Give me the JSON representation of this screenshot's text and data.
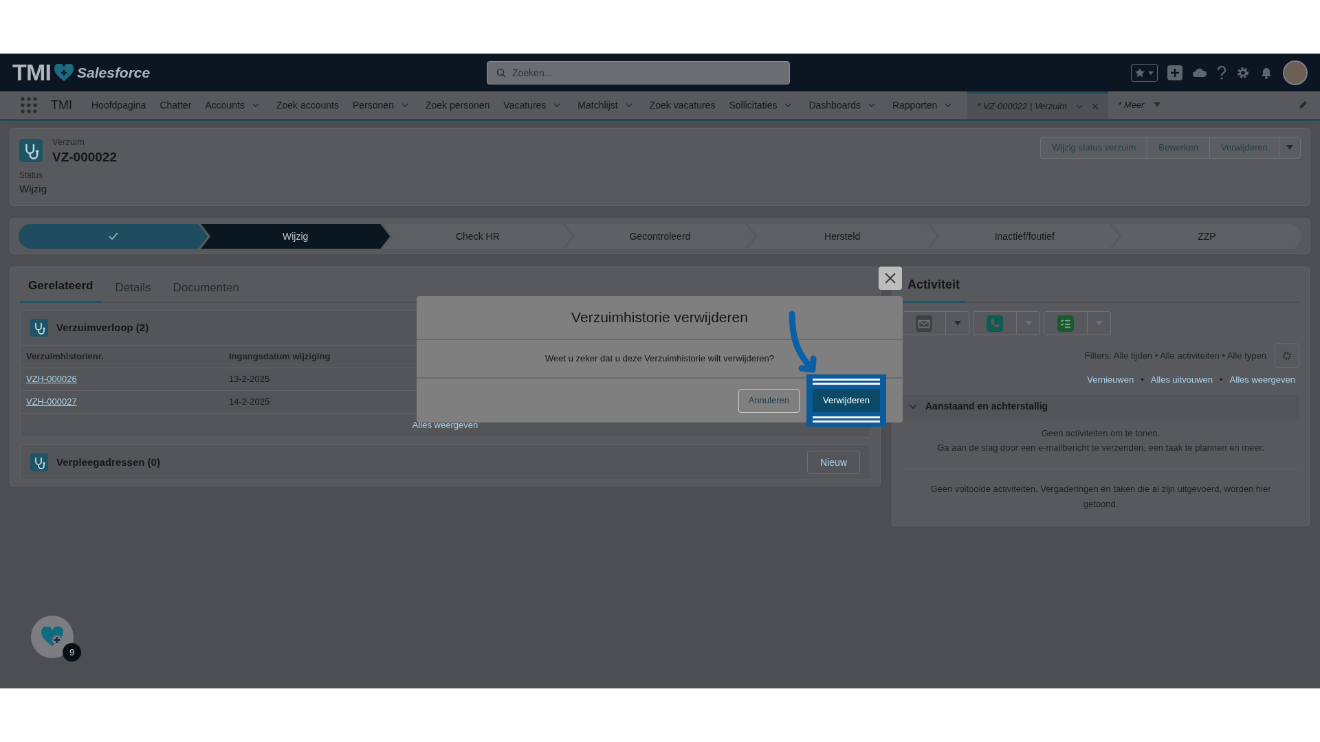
{
  "header": {
    "brand": "TMI",
    "brand_sub": "Salesforce",
    "search": {
      "placeholder": "Zoeken..."
    }
  },
  "app_name": "TMI",
  "nav": [
    {
      "label": "Hoofdpagina",
      "dropdown": false
    },
    {
      "label": "Chatter",
      "dropdown": false
    },
    {
      "label": "Accounts",
      "dropdown": true
    },
    {
      "label": "Zoek accounts",
      "dropdown": false
    },
    {
      "label": "Personen",
      "dropdown": true
    },
    {
      "label": "Zoek personen",
      "dropdown": false
    },
    {
      "label": "Vacatures",
      "dropdown": true
    },
    {
      "label": "Matchlijst",
      "dropdown": true
    },
    {
      "label": "Zoek vacatures",
      "dropdown": false
    },
    {
      "label": "Sollicitaties",
      "dropdown": true
    },
    {
      "label": "Dashboards",
      "dropdown": true
    },
    {
      "label": "Rapporten",
      "dropdown": true
    }
  ],
  "workspace_tab": {
    "label": "* VZ-000022 | Verzuim",
    "selected": true
  },
  "more_menu": {
    "label": "* Meer"
  },
  "record": {
    "object": "Verzuim",
    "name": "VZ-000022",
    "actions": [
      "Wijzig status verzuim",
      "Bewerken",
      "Verwijderen"
    ],
    "fields": [
      {
        "label": "Status",
        "value": "Wijzig"
      }
    ]
  },
  "path": [
    {
      "complete": true,
      "selected": false
    },
    {
      "label": "Wijzig",
      "complete": false,
      "selected": true
    },
    {
      "label": "Check HR",
      "complete": false,
      "selected": false
    },
    {
      "label": "Gecontroleerd",
      "complete": false,
      "selected": false
    },
    {
      "label": "Hersteld",
      "complete": false,
      "selected": false
    },
    {
      "label": "Inactief/foutief",
      "complete": false,
      "selected": false
    },
    {
      "label": "ZZP",
      "complete": false,
      "selected": false
    }
  ],
  "related_tabs": [
    {
      "label": "Gerelateerd",
      "selected": true
    },
    {
      "label": "Details",
      "selected": false
    },
    {
      "label": "Documenten",
      "selected": false
    }
  ],
  "related_lists": [
    {
      "kind": "table",
      "title": "Verzuimverloop (2)",
      "columns": [
        "Verzuimhistorienr.",
        "Ingangsdatum wijziging"
      ],
      "rows": [
        [
          "VZH-000026",
          "13-2-2025"
        ],
        [
          "VZH-000027",
          "14-2-2025"
        ]
      ],
      "footer_link": "Alles weergeven"
    },
    {
      "kind": "empty",
      "title": "Verpleegadressen (0)",
      "button": "Nieuw"
    }
  ],
  "modal": {
    "title": "Verzuimhistorie verwijderen",
    "message": "Weet u zeker dat u deze Verzuimhistorie wilt verwijderen?",
    "buttons": [
      {
        "label": "Annuleren",
        "kind": "neutral"
      },
      {
        "label": "Verwijderen",
        "kind": "brand"
      }
    ]
  },
  "activity": {
    "tabs": [
      {
        "label": "Activiteit",
        "selected": true
      }
    ],
    "filters": "Filters: Alle tijden • Alle activiteiten • Alle typen",
    "links": [
      "Vernieuwen",
      "Alles uitvouwen",
      "Alles weergeven"
    ],
    "separator": "•",
    "section": {
      "title": "Aanstaand en achterstallig",
      "expanded": true,
      "messages": [
        "Geen activiteiten om te tonen.",
        "Ga aan de slag door een e-mailbericht te verzenden, een taak te plannen en meer."
      ]
    },
    "completed_message": "Geen voltooide activiteiten. Vergaderingen en taken die al zijn uitgevoerd, worden hier getoond."
  },
  "floating_button": {
    "badge": "9"
  }
}
